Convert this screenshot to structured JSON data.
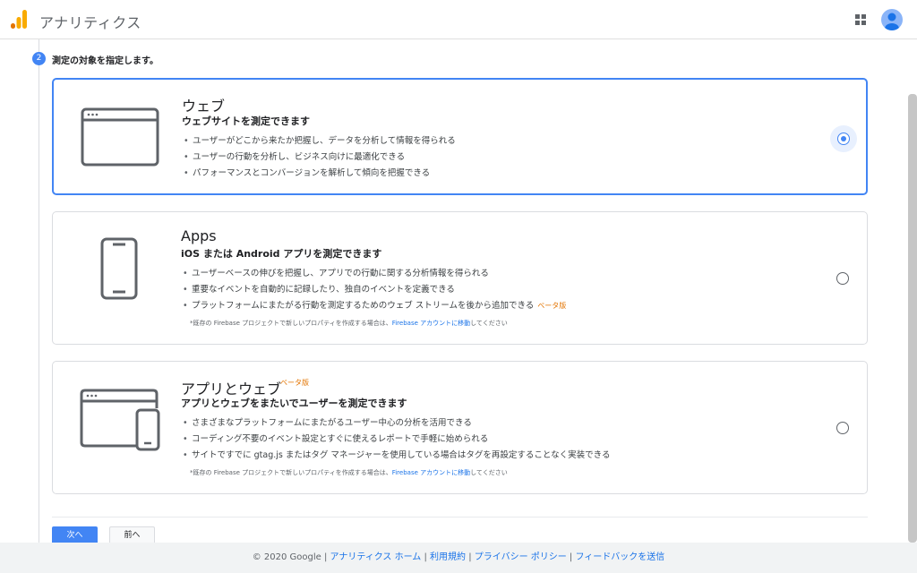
{
  "header": {
    "app_title": "アナリティクス",
    "logo_icon": "analytics-logo-icon",
    "apps_icon": "grid-apps-icon",
    "avatar_icon": "user-avatar-icon"
  },
  "step": {
    "number": "2",
    "title": "測定の対象を指定します。"
  },
  "cards": [
    {
      "title": "ウェブ",
      "subtitle": "ウェブサイトを測定できます",
      "bullets": [
        "ユーザーがどこから来たか把握し、データを分析して情報を得られる",
        "ユーザーの行動を分析し、ビジネス向けに最適化できる",
        "パフォーマンスとコンバージョンを解析して傾向を把握できる"
      ],
      "selected": true
    },
    {
      "title": "Apps",
      "subtitle": "iOS または Android アプリを測定できます",
      "bullets": [
        "ユーザーベースの伸びを把握し、アプリでの行動に関する分析情報を得られる",
        "重要なイベントを自動的に記録したり、独自のイベントを定義できる",
        "プラットフォームにまたがる行動を測定するためのウェブ ストリームを後から追加できる"
      ],
      "beta": "ベータ版",
      "footnote_pre": "*既存の Firebase プロジェクトで新しいプロパティを作成する場合は、",
      "footnote_link": "Firebase アカウントに移動",
      "footnote_post": "してください",
      "selected": false
    },
    {
      "title": "アプリとウェブ",
      "title_beta": "ベータ版",
      "subtitle": "アプリとウェブをまたいでユーザーを測定できます",
      "bullets": [
        "さまざまなプラットフォームにまたがるユーザー中心の分析を活用できる",
        "コーディング不要のイベント設定とすぐに使えるレポートで手軽に始められる",
        "サイトですでに gtag.js またはタグ マネージャーを使用している場合はタグを再設定することなく実装できる"
      ],
      "footnote_pre": "*既存の Firebase プロジェクトで新しいプロパティを作成する場合は、",
      "footnote_link": "Firebase アカウントに移動",
      "footnote_post": "してください",
      "selected": false
    }
  ],
  "buttons": {
    "next": "次へ",
    "prev": "前へ"
  },
  "footer": {
    "copyright": "© 2020 Google",
    "links": [
      "アナリティクス ホーム",
      "利用規約",
      "プライバシー ポリシー",
      "フィードバックを送信"
    ]
  },
  "colors": {
    "accent": "#4285f4",
    "beta": "#e37400",
    "link": "#1a73e8"
  }
}
